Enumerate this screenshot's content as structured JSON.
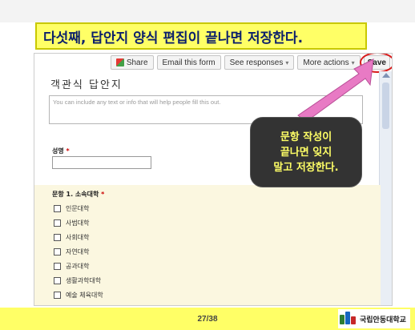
{
  "headline": "다섯째, 답안지 양식 편집이 끝나면 저장한다.",
  "toolbar": {
    "share_label": "Share",
    "email_label": "Email this form",
    "responses_label": "See responses",
    "more_label": "More actions",
    "save_label": "Save",
    "share_icon": "google-share-icon",
    "caret": "▾"
  },
  "form": {
    "title": "객관식 답안지",
    "description_placeholder": "You can include any text or info that will help people fill this out.",
    "name_label": "성명",
    "required_mark": "*",
    "question_title": "문항 1. 소속대학",
    "options": [
      "인문대학",
      "사범대학",
      "사회대학",
      "자연대학",
      "공과대학",
      "생활과학대학",
      "예술 체육대학"
    ]
  },
  "callout": {
    "lines": [
      "문항 작성이",
      "끝나면 잊지",
      "말고 저장한다."
    ]
  },
  "footer": {
    "page": "27/38",
    "logo_name": "국립안동대학교"
  },
  "colors": {
    "headline_bg": "#ffff66",
    "headline_text": "#0b1f6b",
    "callout_bg": "#333333",
    "callout_text": "#ffff66",
    "arrow": "#e87ac4",
    "save_circle": "#d81b1b",
    "footer_bg": "#ffff66"
  }
}
